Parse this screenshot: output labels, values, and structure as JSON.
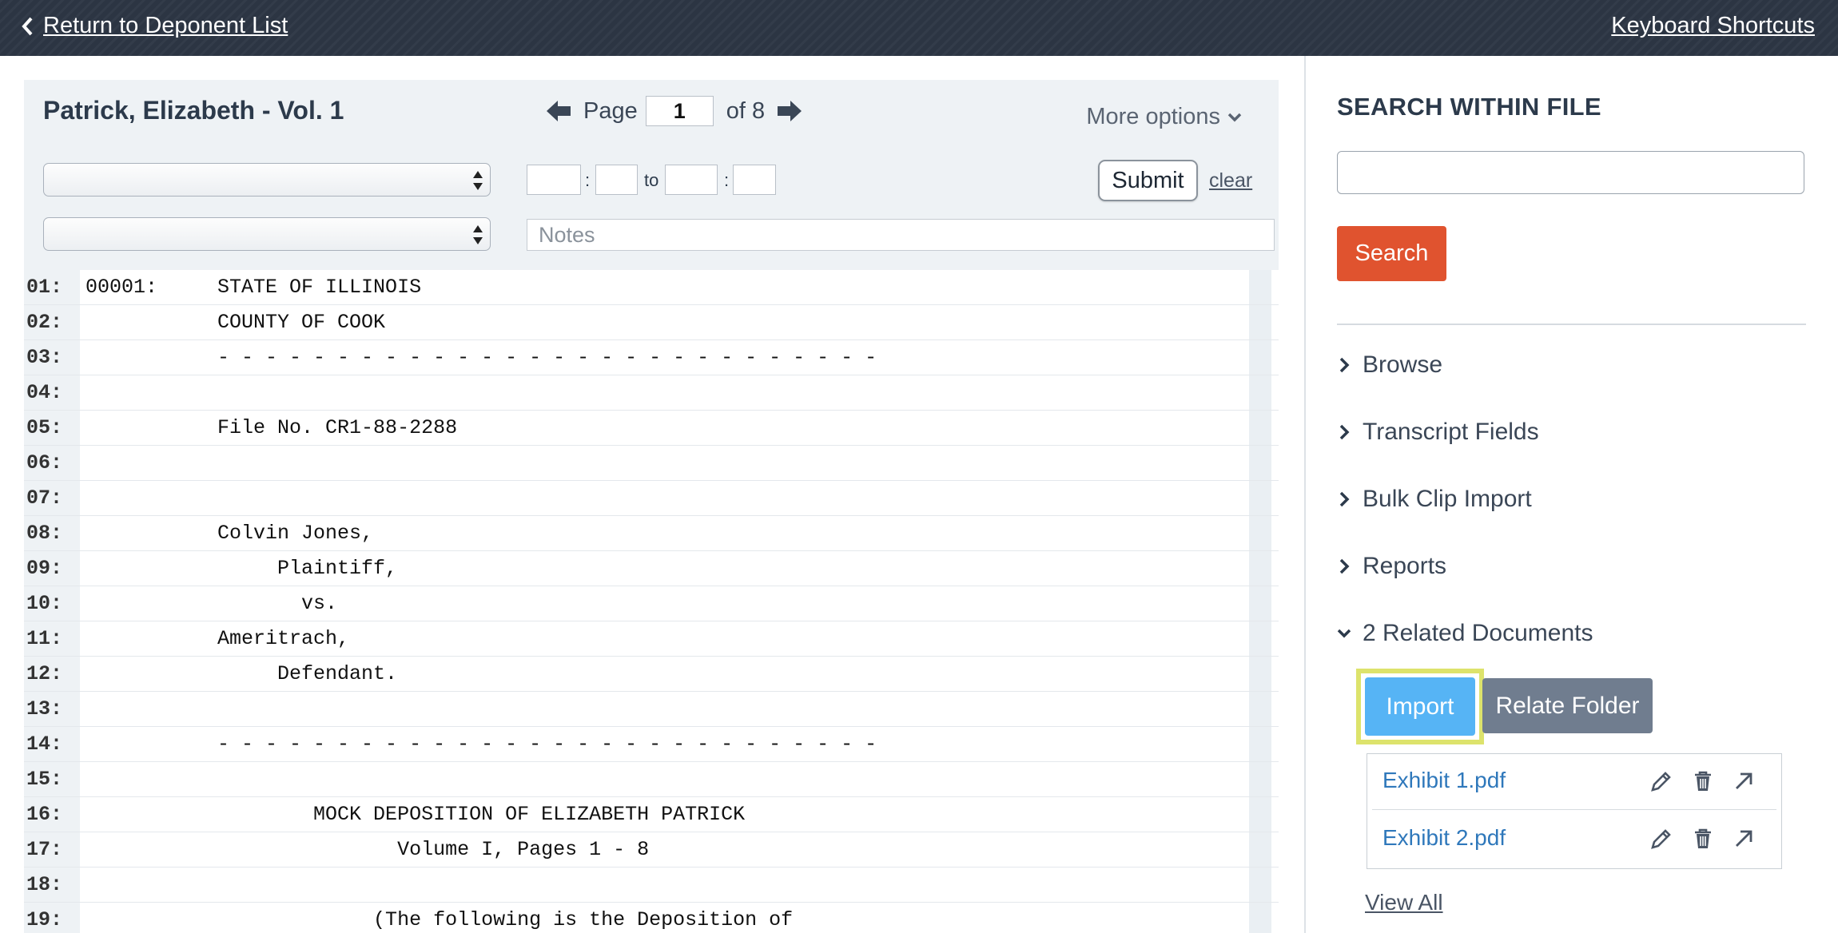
{
  "topbar": {
    "back_label": "Return to Deponent List",
    "shortcuts_label": "Keyboard Shortcuts"
  },
  "viewer": {
    "title": "Patrick, Elizabeth - Vol. 1",
    "page_label": "Page",
    "current_page": "1",
    "of_label": "of 8",
    "more_options": "More options",
    "to_label": "to",
    "colon": ":",
    "submit_label": "Submit",
    "clear_label": "clear",
    "notes_placeholder": "Notes"
  },
  "transcript": {
    "lines": [
      {
        "n": "01:",
        "t": "00001:     STATE OF ILLINOIS"
      },
      {
        "n": "02:",
        "t": "           COUNTY OF COOK"
      },
      {
        "n": "03:",
        "t": "           - - - - - - - - - - - - - - - - - - - - - - - - - - - -"
      },
      {
        "n": "04:",
        "t": ""
      },
      {
        "n": "05:",
        "t": "           File No. CR1-88-2288"
      },
      {
        "n": "06:",
        "t": ""
      },
      {
        "n": "07:",
        "t": ""
      },
      {
        "n": "08:",
        "t": "           Colvin Jones,"
      },
      {
        "n": "09:",
        "t": "                Plaintiff,"
      },
      {
        "n": "10:",
        "t": "                  vs."
      },
      {
        "n": "11:",
        "t": "           Ameritrach,"
      },
      {
        "n": "12:",
        "t": "                Defendant."
      },
      {
        "n": "13:",
        "t": ""
      },
      {
        "n": "14:",
        "t": "           - - - - - - - - - - - - - - - - - - - - - - - - - - - -"
      },
      {
        "n": "15:",
        "t": ""
      },
      {
        "n": "16:",
        "t": "                   MOCK DEPOSITION OF ELIZABETH PATRICK"
      },
      {
        "n": "17:",
        "t": "                          Volume I, Pages 1 - 8"
      },
      {
        "n": "18:",
        "t": ""
      },
      {
        "n": "19:",
        "t": "                        (The following is the Deposition of"
      }
    ]
  },
  "sidebar": {
    "search_heading": "SEARCH WITHIN FILE",
    "search_button": "Search",
    "sections": [
      "Browse",
      "Transcript Fields",
      "Bulk Clip Import",
      "Reports"
    ],
    "related_label": "2 Related Documents",
    "import_label": "Import",
    "relate_folder_label": "Relate Folder",
    "documents": [
      "Exhibit 1.pdf",
      "Exhibit 2.pdf"
    ],
    "view_all_label": "View All"
  },
  "colors": {
    "topbar": "#2c3543",
    "search_button": "#e0532f",
    "import_button": "#56b4f5",
    "import_highlight": "#dde36c",
    "relate_button": "#707d8f",
    "link": "#2f78bb"
  },
  "icons": [
    "chevron-left-icon",
    "arrow-left-icon",
    "arrow-right-icon",
    "chevron-down-icon",
    "chevron-right-icon",
    "pencil-icon",
    "trash-icon",
    "open-external-icon",
    "select-updown-icon"
  ]
}
